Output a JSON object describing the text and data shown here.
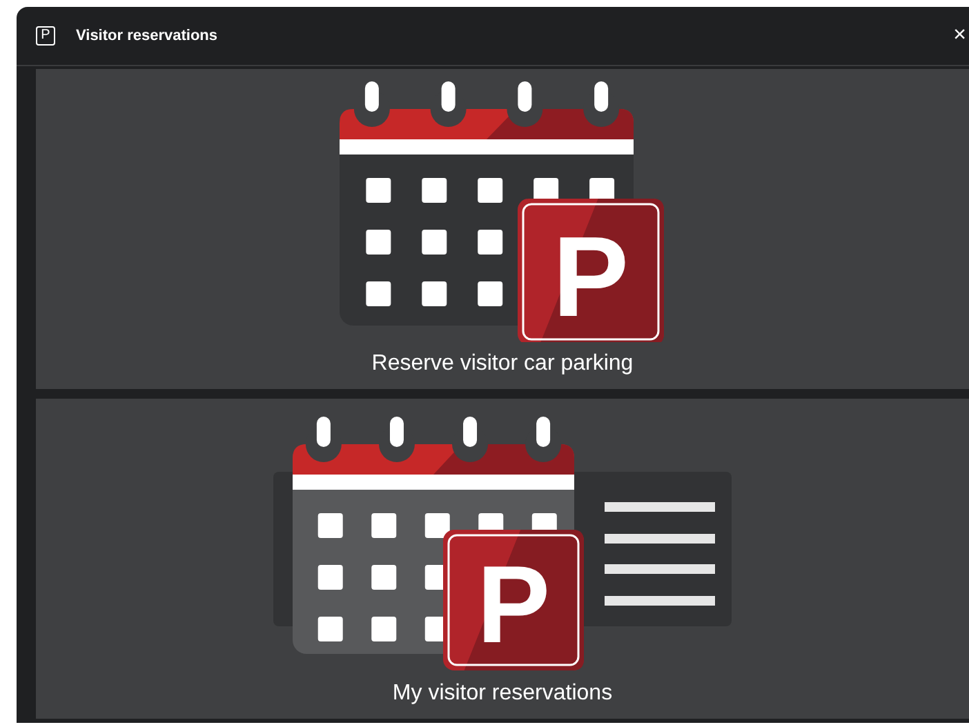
{
  "window": {
    "icon_letter": "P",
    "title": "Visitor reservations",
    "close": "×"
  },
  "tiles": [
    {
      "kind": "reserve",
      "badge_letter": "P",
      "label": "Reserve visitor car parking"
    },
    {
      "kind": "list",
      "badge_letter": "P",
      "label": "My visitor reservations"
    }
  ]
}
